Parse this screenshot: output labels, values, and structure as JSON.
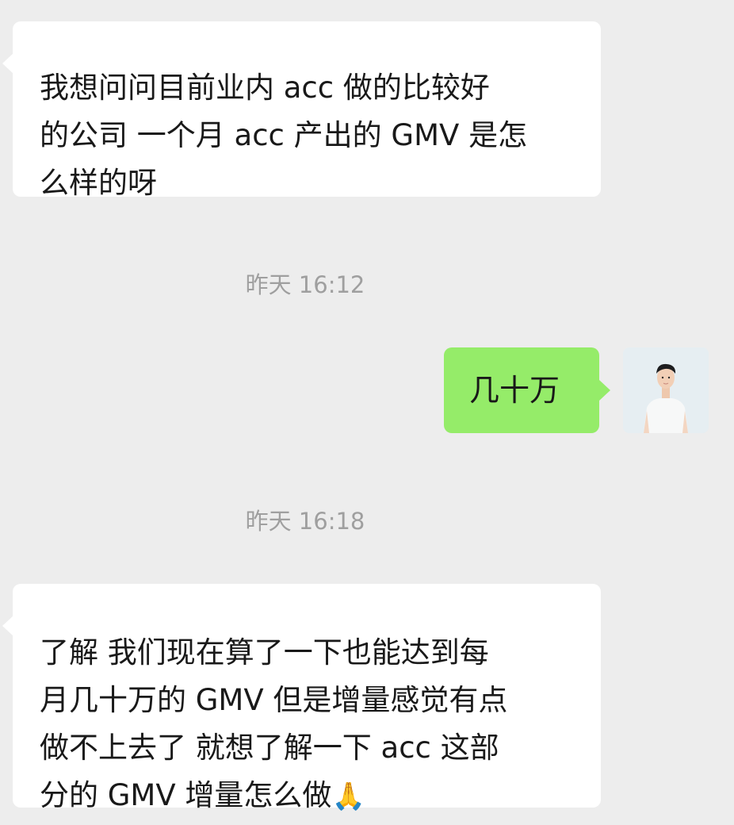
{
  "messages": [
    {
      "direction": "incoming",
      "lines": [
        "我想问问目前业内 acc 做的比较好",
        "的公司 一个月 acc 产出的 GMV 是怎",
        "么样的呀"
      ]
    },
    {
      "direction": "outgoing",
      "text": "几十万",
      "avatar_icon": "user-photo"
    },
    {
      "direction": "incoming",
      "lines": [
        "了解 我们现在算了一下也能达到每",
        "月几十万的 GMV 但是增量感觉有点",
        "做不上去了 就想了解一下 acc 这部",
        "分的 GMV 增量怎么做"
      ],
      "emoji": "🙏"
    }
  ],
  "timestamps": [
    "昨天 16:12",
    "昨天 16:18"
  ],
  "colors": {
    "background": "#ededed",
    "incoming_bubble": "#ffffff",
    "outgoing_bubble": "#95ec69",
    "timestamp_text": "#9f9f9f"
  }
}
